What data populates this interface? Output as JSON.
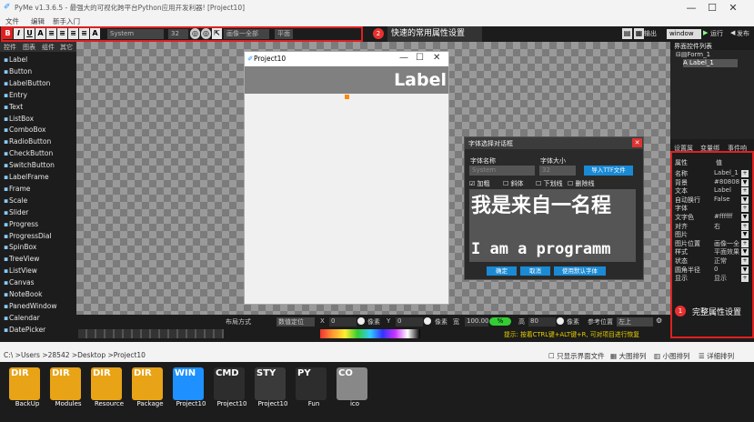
{
  "app": {
    "title": "PyMe v1.3.6.5 - 最强大的可视化跨平台Python应用开发利器! [Project10]"
  },
  "menu": [
    "文件",
    "编辑",
    "新手入门"
  ],
  "toolbar": {
    "font": "System",
    "size": "32",
    "image": "画像一全部",
    "flat": "平面",
    "out": "输出",
    "window": "window",
    "run": "运行",
    "publish": "发布"
  },
  "annotation_toolbar": {
    "num": "2",
    "text": "快速的常用属性设置"
  },
  "annotation_props": {
    "num": "1",
    "text": "完整属性设置"
  },
  "left_tabs": [
    "控件",
    "图表",
    "组件",
    "其它"
  ],
  "controls": [
    "Label",
    "Button",
    "LabelButton",
    "Entry",
    "Text",
    "ListBox",
    "ComboBox",
    "RadioButton",
    "CheckButton",
    "SwitchButton",
    "LabelFrame",
    "Frame",
    "Scale",
    "Slider",
    "Progress",
    "ProgressDial",
    "SpinBox",
    "TreeView",
    "ListView",
    "Canvas",
    "NoteBook",
    "PanedWindow",
    "Calendar",
    "DatePicker"
  ],
  "form": {
    "title": "Project10",
    "label": "Label"
  },
  "dialog": {
    "title": "字体选择对话框",
    "name_label": "字体名称",
    "size_label": "字体大小",
    "font": "System",
    "size": "32",
    "import": "导入TTF文件",
    "bold": "加粗",
    "italic": "斜体",
    "underline": "下划线",
    "strike": "删除线",
    "preview1": "我是来自一名程",
    "preview2": "I am a programm",
    "ok": "确定",
    "cancel": "取消",
    "default": "使用默认字体"
  },
  "right": {
    "title": "界面控件列表",
    "tree": [
      "Form_1",
      "Label_1"
    ],
    "tabs": [
      "设置属",
      "变量绑",
      "事件响"
    ],
    "head_name": "属性",
    "head_val": "值",
    "props": [
      [
        "名称",
        "Label_1"
      ],
      [
        "背景",
        "#80808"
      ],
      [
        "文本",
        "Label"
      ],
      [
        "自动换行",
        "False"
      ],
      [
        "字体",
        ""
      ],
      [
        "文字色",
        "#ffffff"
      ],
      [
        "对齐",
        "右"
      ],
      [
        "图片",
        ""
      ],
      [
        "图片位置",
        "画像一全"
      ],
      [
        "样式",
        "平面效果"
      ],
      [
        "状态",
        "正常"
      ],
      [
        "圆角半径",
        "0"
      ],
      [
        "显示",
        "显示"
      ]
    ]
  },
  "bottom": {
    "layout": "布局方式",
    "pos": "数值定位",
    "x": "X",
    "xv": "0",
    "px1": "像素",
    "y": "Y",
    "yv": "0",
    "px2": "像素",
    "w": "宽",
    "wv": "100.00",
    "pct": "%",
    "h": "高",
    "hv": "80",
    "px3": "像素",
    "ref": "参考位置",
    "refv": "左上",
    "tip": "提示: 按着CTRL键+ALT键+R, 可对项目进行恢复"
  },
  "path": {
    "text": "C:\\ >Users >28542 >Desktop >Project10",
    "only": "只显示界面文件",
    "big": "大图排列",
    "small": "小图排列",
    "detail": "详细排列"
  },
  "files": [
    {
      "tag": "DIR",
      "name": "BackUp",
      "c": "#e8a317"
    },
    {
      "tag": "DIR",
      "name": "Modules",
      "c": "#e8a317"
    },
    {
      "tag": "DIR",
      "name": "Resource",
      "c": "#e8a317"
    },
    {
      "tag": "DIR",
      "name": "Package",
      "c": "#e8a317"
    },
    {
      "tag": "WIN",
      "name": "Project10",
      "c": "#1e90ff"
    },
    {
      "tag": "CMD",
      "name": "Project10",
      "c": "#2d2d2d"
    },
    {
      "tag": "STY",
      "name": "Project10",
      "c": "#3a3a3a"
    },
    {
      "tag": "PY",
      "name": "Fun",
      "c": "#2d2d2d"
    },
    {
      "tag": "CO",
      "name": "ico",
      "c": "#888888"
    }
  ]
}
